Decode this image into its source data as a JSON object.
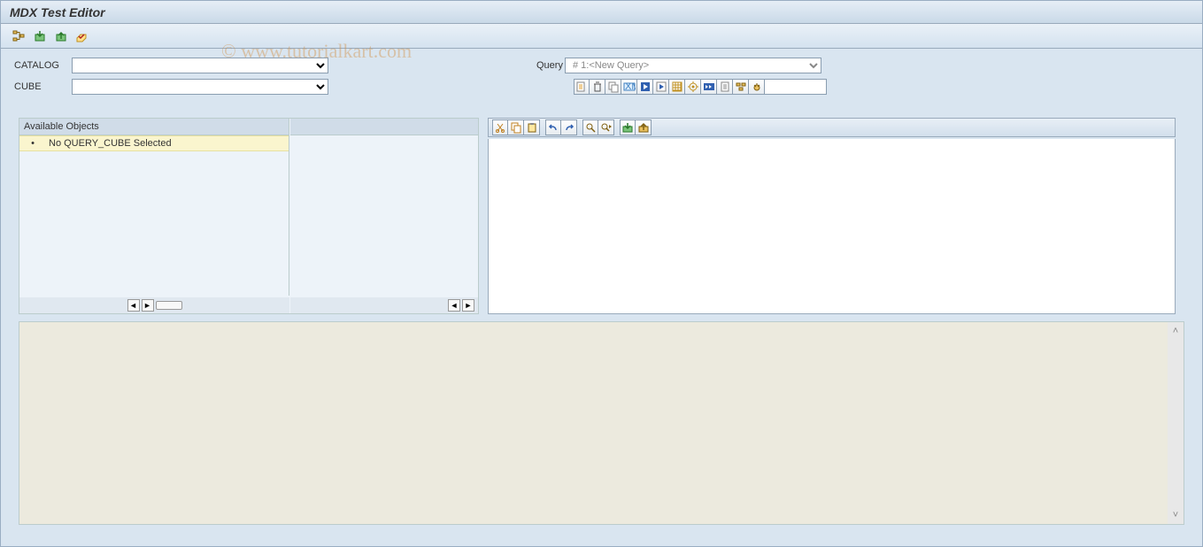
{
  "title": "MDX Test Editor",
  "watermark": "© www.tutorialkart.com",
  "app_toolbar": {
    "icons": [
      "tree",
      "import",
      "export",
      "edit"
    ]
  },
  "params": {
    "catalog_label": "CATALOG",
    "catalog_value": "",
    "cube_label": "CUBE",
    "cube_value": "",
    "query_label": "Query",
    "query_value": "#  1:<New Query>"
  },
  "query_toolbar": {
    "icons": [
      "new",
      "delete",
      "copy",
      "xml",
      "execute-blue",
      "execute",
      "grid",
      "settings",
      "run-fwd",
      "doc",
      "flatten",
      "debug"
    ],
    "input_value": ""
  },
  "objects_panel": {
    "header": "Available Objects",
    "empty_msg": "No QUERY_CUBE Selected"
  },
  "editor_toolbar": {
    "groups": [
      [
        "cut",
        "copy",
        "paste"
      ],
      [
        "undo",
        "redo"
      ],
      [
        "find",
        "find-next"
      ],
      [
        "load",
        "save"
      ]
    ]
  },
  "editor": {
    "content": ""
  },
  "output": {
    "content": ""
  }
}
